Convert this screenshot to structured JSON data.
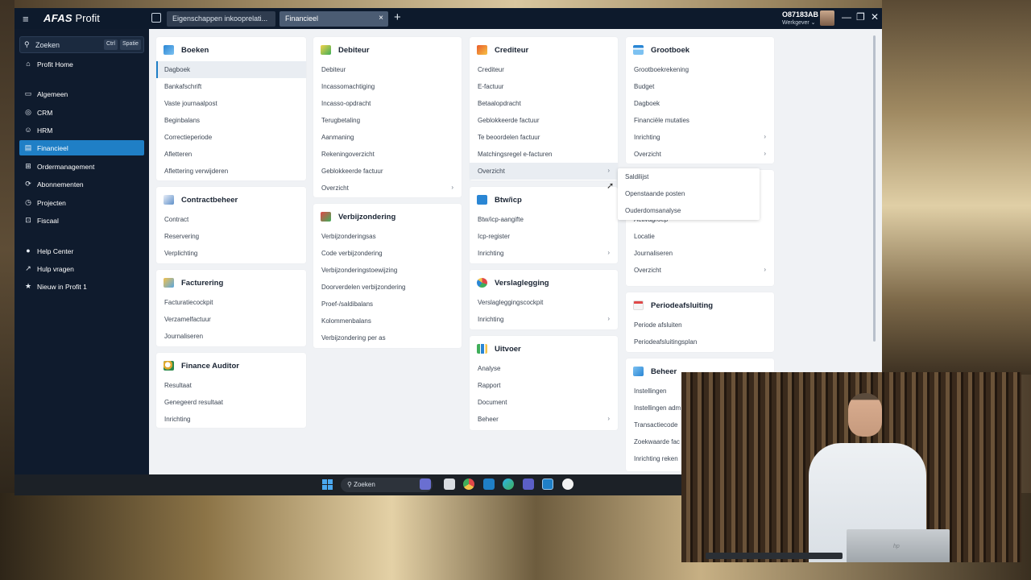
{
  "app": {
    "brand_bold": "AFAS",
    "brand_rest": " Profit",
    "tabs": [
      {
        "label": "Eigenschappen inkooprelati..."
      },
      {
        "label": "Financieel",
        "close": "×"
      }
    ],
    "add_tab": "+",
    "user_code": "O87183AB",
    "user_role": "Werkgever ⌄",
    "window_controls": [
      "—",
      "❐",
      "✕"
    ]
  },
  "sidebar": {
    "search_placeholder": "Zoeken",
    "kbd1": "Ctrl",
    "kbd2": "Spatie",
    "items": [
      {
        "label": "Profit Home",
        "icon": "home-icon",
        "glyph": "⌂"
      },
      {
        "label": "Algemeen",
        "icon": "card-icon",
        "glyph": "▭"
      },
      {
        "label": "CRM",
        "icon": "target-icon",
        "glyph": "◎"
      },
      {
        "label": "HRM",
        "icon": "people-icon",
        "glyph": "☺"
      },
      {
        "label": "Financieel",
        "icon": "chart-icon",
        "glyph": "▤",
        "active": true
      },
      {
        "label": "Ordermanagement",
        "icon": "cart-icon",
        "glyph": "⊞"
      },
      {
        "label": "Abonnementen",
        "icon": "refresh-icon",
        "glyph": "⟳"
      },
      {
        "label": "Projecten",
        "icon": "clock-icon",
        "glyph": "◷"
      },
      {
        "label": "Fiscaal",
        "icon": "tray-icon",
        "glyph": "⊡"
      },
      {
        "label": "Help Center",
        "icon": "bulb-icon",
        "glyph": "●"
      },
      {
        "label": "Hulp vragen",
        "icon": "external-icon",
        "glyph": "↗"
      },
      {
        "label": "Nieuw in Profit 1",
        "icon": "star-icon",
        "glyph": "★"
      }
    ]
  },
  "cards": {
    "boeken": {
      "title": "Boeken",
      "items": [
        "Dagboek",
        "Bankafschrift",
        "Vaste journaalpost",
        "Beginbalans",
        "Correctieperiode",
        "Afletteren",
        "Aflettering verwijderen"
      ]
    },
    "contractbeheer": {
      "title": "Contractbeheer",
      "items": [
        "Contract",
        "Reservering",
        "Verplichting"
      ]
    },
    "facturering": {
      "title": "Facturering",
      "items": [
        "Facturatiecockpit",
        "Verzamelfactuur",
        "Journaliseren"
      ]
    },
    "finance_auditor": {
      "title": "Finance Auditor",
      "items": [
        "Resultaat",
        "Genegeerd resultaat",
        "Inrichting"
      ]
    },
    "debiteur": {
      "title": "Debiteur",
      "items": [
        "Debiteur",
        "Incassomachtiging",
        "Incasso-opdracht",
        "Terugbetaling",
        "Aanmaning",
        "Rekeningoverzicht",
        "Geblokkeerde factuur",
        "Overzicht"
      ]
    },
    "verbijzondering": {
      "title": "Verbijzondering",
      "items": [
        "Verbijzonderingsas",
        "Code verbijzondering",
        "Verbijzonderingstoewijzing",
        "Doorverdelen verbijzondering",
        "Proef-/saldibalans",
        "Kolommenbalans",
        "Verbijzondering per as"
      ]
    },
    "crediteur": {
      "title": "Crediteur",
      "items": [
        "Crediteur",
        "E-factuur",
        "Betaalopdracht",
        "Geblokkeerde factuur",
        "Te beoordelen factuur",
        "Matchingsregel e-facturen",
        "Overzicht"
      ]
    },
    "btw": {
      "title": "Btw/icp",
      "items": [
        "Btw/icp-aangifte",
        "Icp-register",
        "Inrichting"
      ]
    },
    "verslaglegging": {
      "title": "Verslaglegging",
      "items": [
        "Verslagleggingscockpit",
        "Inrichting"
      ]
    },
    "uitvoer": {
      "title": "Uitvoer",
      "items": [
        "Analyse",
        "Rapport",
        "Document",
        "Beheer"
      ]
    },
    "grootboek": {
      "title": "Grootboek",
      "items": [
        "Grootboekrekening",
        "Budget",
        "Dagboek",
        "Financiële mutaties",
        "Inrichting",
        "Overzicht"
      ]
    },
    "activa": {
      "items": [
        "Activagroep",
        "Locatie",
        "Journaliseren",
        "Overzicht"
      ]
    },
    "periodeafsluiting": {
      "title": "Periodeafsluiting",
      "items": [
        "Periode afsluiten",
        "Periodeafsluitingsplan"
      ]
    },
    "beheer": {
      "title": "Beheer",
      "items": [
        "Instellingen",
        "Instellingen adm",
        "Transactiecode",
        "Zoekwaarde fac",
        "Inrichting reken"
      ]
    }
  },
  "flyout": {
    "items": [
      "Saldilijst",
      "Openstaande posten",
      "Ouderdomsanalyse"
    ]
  },
  "taskbar": {
    "search_label": "Zoeken"
  },
  "presenter": {
    "laptop_logo": "hp"
  },
  "colors": {
    "accent": "#1f7fc6",
    "sidebar_bg": "#0f1b2d",
    "main_bg": "#f0f2f5"
  }
}
